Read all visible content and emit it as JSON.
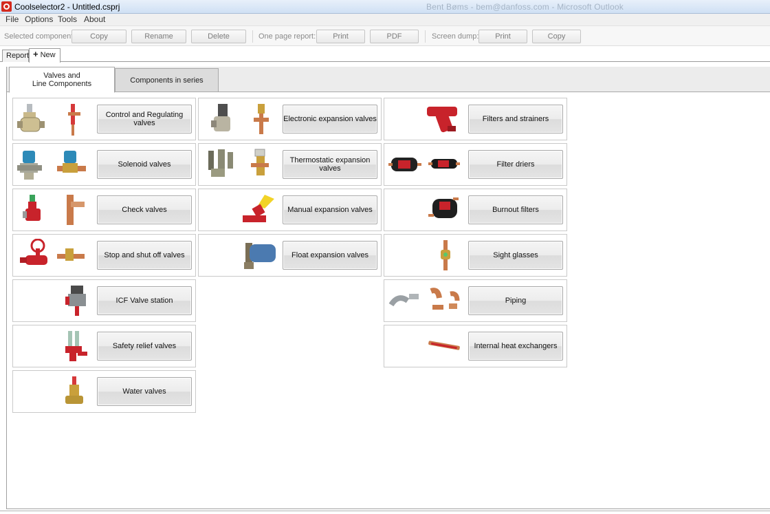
{
  "window": {
    "title": "Coolselector2 - Untitled.csprj",
    "background_title": "Bent Bøms - bem@danfoss.com - Microsoft Outlook"
  },
  "menu": [
    "File",
    "Options",
    "Tools",
    "About"
  ],
  "toolbar": {
    "selected_label": "Selected component:",
    "copy": "Copy",
    "rename": "Rename",
    "delete": "Delete",
    "report_label": "One page report:",
    "report_print": "Print",
    "report_pdf": "PDF",
    "dump_label": "Screen dump:",
    "dump_print": "Print",
    "dump_copy": "Copy"
  },
  "doc_tabs": {
    "report": "Report",
    "new": "New"
  },
  "category_tabs": {
    "valves_line1": "Valves and",
    "valves_line2": "Line Components",
    "series": "Components in series"
  },
  "components": {
    "col1": [
      "Control and Regulating valves",
      "Solenoid valves",
      "Check valves",
      "Stop and shut off valves",
      "ICF Valve station",
      "Safety relief valves",
      "Water valves"
    ],
    "col2": [
      "Electronic expansion valves",
      "Thermostatic expansion valves",
      "Manual expansion valves",
      "Float expansion valves"
    ],
    "col3": [
      "Filters and strainers",
      "Filter driers",
      "Burnout filters",
      "Sight glasses",
      "Piping",
      "Internal heat exchangers"
    ]
  },
  "colors": {
    "valve_red": "#c8232b",
    "brass": "#c9a03c",
    "copper": "#c97a4a",
    "steel": "#9aa0a4",
    "solenoid_blue": "#2d8ab8"
  }
}
